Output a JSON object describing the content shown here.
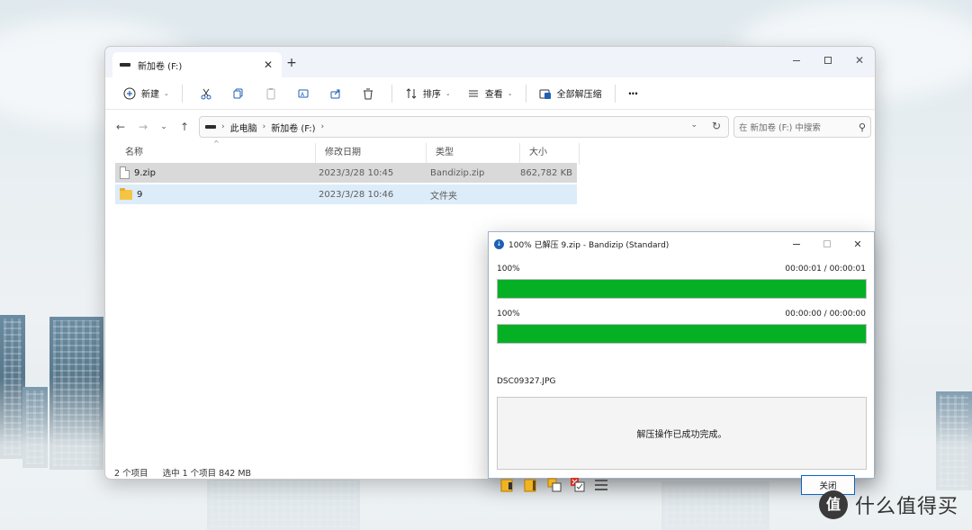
{
  "explorer": {
    "tab_label": "新加卷 (F:)",
    "tab_close": "✕",
    "new_tab": "+",
    "toolbar": {
      "new_label": "新建",
      "sort_label": "排序",
      "view_label": "查看",
      "extract_all_label": "全部解压缩",
      "more_label": "···"
    },
    "address": {
      "crumbs": [
        "此电脑",
        "新加卷 (F:)"
      ]
    },
    "search_placeholder": "在 新加卷 (F:) 中搜索",
    "columns": [
      "名称",
      "修改日期",
      "类型",
      "大小"
    ],
    "rows": [
      {
        "name": "9.zip",
        "date": "2023/3/28 10:45",
        "type": "Bandizip.zip",
        "size": "862,782 KB"
      },
      {
        "name": "9",
        "date": "2023/3/28 10:46",
        "type": "文件夹",
        "size": ""
      }
    ],
    "status": {
      "item_count": "2 个项目",
      "selection": "选中 1 个项目  842 MB"
    }
  },
  "bandizip": {
    "title": "100% 已解压 9.zip - Bandizip (Standard)",
    "progress1": {
      "percent_text": "100%",
      "time": "00:00:01 / 00:00:01",
      "fraction": 1.0
    },
    "progress2": {
      "percent_text": "100%",
      "time": "00:00:00 / 00:00:00",
      "fraction": 1.0
    },
    "current_file": "DSC09327.JPG",
    "message": "解压操作已成功完成。",
    "close_label": "关闭",
    "accent_color": "#06b025"
  },
  "watermark": {
    "logo_char": "值",
    "text": "什么值得买"
  }
}
